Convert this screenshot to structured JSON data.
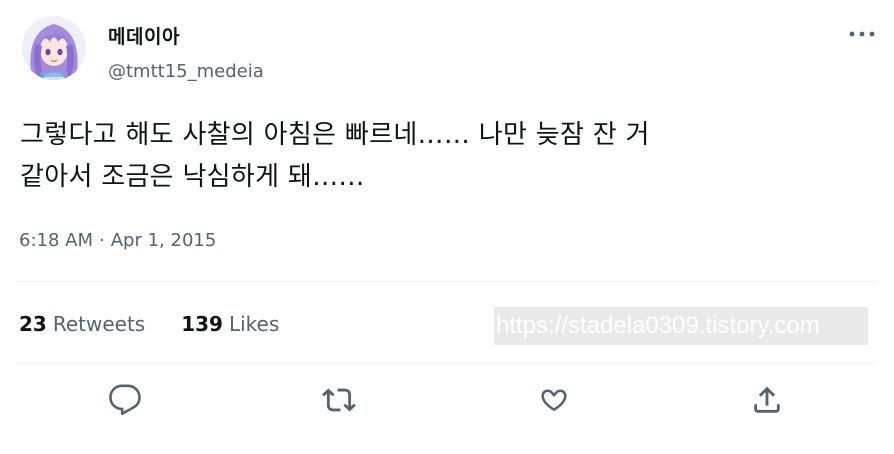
{
  "user": {
    "display_name": "메데이아",
    "handle": "@tmtt15_medeia",
    "avatar_icon": "anime-avatar-purple-hair"
  },
  "menu": {
    "icon": "more-horizontal-icon"
  },
  "tweet": {
    "line1": "그렇다고 해도 사찰의 아침은 빠르네…… 나만 늦잠 잔 거",
    "line2": "같아서 조금은 낙심하게 돼……",
    "time": "6:18 AM",
    "separator": "·",
    "date": "Apr 1, 2015"
  },
  "stats": {
    "retweets_count": "23",
    "retweets_label": "Retweets",
    "likes_count": "139",
    "likes_label": "Likes"
  },
  "watermark": {
    "text": "https://stadela0309.tistory.com"
  },
  "actions": {
    "reply_icon": "reply-icon",
    "retweet_icon": "retweet-icon",
    "like_icon": "heart-icon",
    "share_icon": "share-icon"
  },
  "colors": {
    "text_primary": "#0f1419",
    "text_secondary": "#536471",
    "divider": "#eff3f4",
    "watermark_bg": "#e9e9e9"
  }
}
